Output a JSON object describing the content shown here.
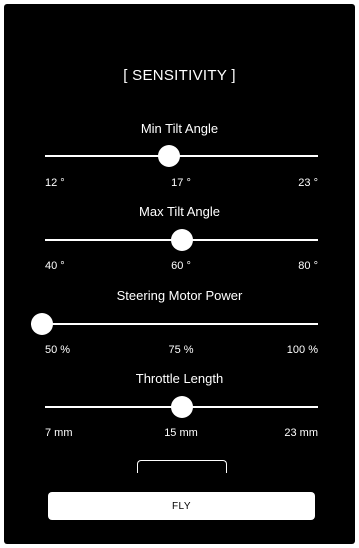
{
  "header": {
    "title": "[ SENSITIVITY ]"
  },
  "settings": [
    {
      "label": "Min Tilt Angle",
      "value": 17,
      "min": 12,
      "max": 23,
      "ticks": [
        "12 °",
        "17 °",
        "23 °"
      ]
    },
    {
      "label": "Max Tilt Angle",
      "value": 60,
      "min": 40,
      "max": 80,
      "ticks": [
        "40 °",
        "60 °",
        "80 °"
      ]
    },
    {
      "label": "Steering Motor Power",
      "value": 50,
      "min": 50,
      "max": 100,
      "ticks": [
        "50 %",
        "75 %",
        "100 %"
      ]
    },
    {
      "label": "Throttle Length",
      "value": 15,
      "min": 7,
      "max": 23,
      "ticks": [
        "7 mm",
        "15 mm",
        "23 mm"
      ]
    }
  ],
  "actions": {
    "fly_label": "FLY"
  },
  "colors": {
    "background": "#000000",
    "foreground": "#ffffff"
  }
}
